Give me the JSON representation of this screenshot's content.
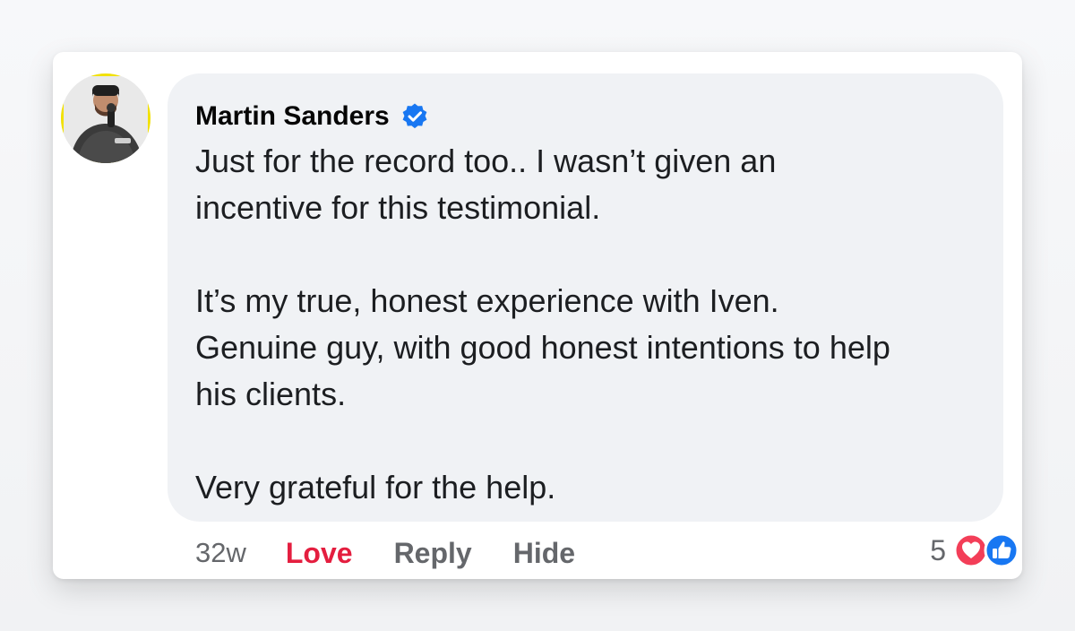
{
  "comment": {
    "author": "Martin Sanders",
    "verified_icon": "verified-badge-icon",
    "lines": [
      "Just for the record too.. I wasn’t given an",
      "incentive for this testimonial.",
      "It’s my true, honest experience with Iven.",
      "Genuine guy, with good honest intentions to help",
      "his clients.",
      "Very grateful for the help."
    ]
  },
  "actions": {
    "time": "32w",
    "love": "Love",
    "reply": "Reply",
    "hide": "Hide"
  },
  "reactions": {
    "count": "5",
    "icons": [
      "love-reaction-icon",
      "like-reaction-icon"
    ]
  },
  "colors": {
    "verified_blue": "#1877f2",
    "love_red": "#e41e3f",
    "like_blue": "#1877f2",
    "bubble_bg": "#f0f2f5",
    "avatar_ring": "#f2e100"
  }
}
